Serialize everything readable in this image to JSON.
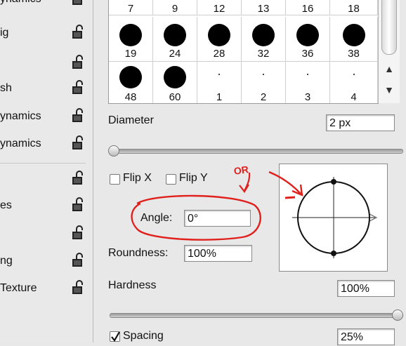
{
  "left_panel": {
    "items": [
      {
        "label": "ynamics"
      },
      {
        "label": "ig"
      },
      {
        "label": ""
      },
      {
        "label": "sh"
      },
      {
        "label": "ynamics"
      },
      {
        "label": "ynamics"
      },
      {
        "label": ""
      },
      {
        "label": "es"
      },
      {
        "label": ""
      },
      {
        "label": "ng"
      },
      {
        "label": "Texture"
      }
    ]
  },
  "brush_grid": {
    "row1": [
      "7",
      "9",
      "12",
      "13",
      "16",
      "18"
    ],
    "row2": [
      "19",
      "24",
      "28",
      "32",
      "36",
      "38"
    ],
    "row3": [
      "48",
      "60",
      "1",
      "2",
      "3",
      "4"
    ]
  },
  "diameter": {
    "label": "Diameter",
    "value": "2 px",
    "slider_fraction": 0.0
  },
  "flip": {
    "x_label": "Flip X",
    "y_label": "Flip Y",
    "x_checked": false,
    "y_checked": false
  },
  "angle": {
    "label": "Angle:",
    "value": "0°"
  },
  "roundness": {
    "label": "Roundness:",
    "value": "100%"
  },
  "hardness": {
    "label": "Hardness",
    "value": "100%",
    "slider_fraction": 1.0
  },
  "spacing": {
    "label": "Spacing",
    "value": "25%",
    "checked": true
  },
  "annotation": {
    "text": "OR",
    "color": "#e0201c"
  },
  "icons": [
    "lock-icon",
    "scroll-up-arrow-icon",
    "scroll-down-arrow-icon",
    "checkmark-icon"
  ]
}
